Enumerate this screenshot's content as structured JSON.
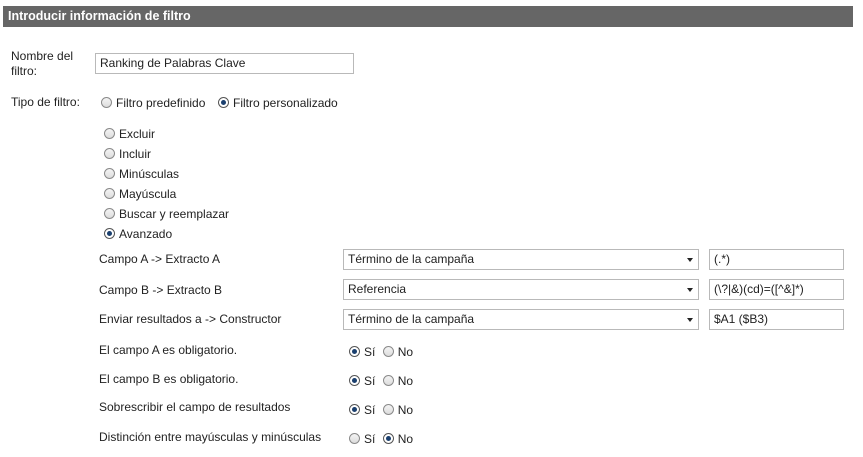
{
  "header": {
    "title": "Introducir información de filtro"
  },
  "name_field": {
    "label_line1": "Nombre del",
    "label_line2": "filtro:",
    "value": "Ranking de Palabras Clave"
  },
  "filter_type": {
    "label": "Tipo de filtro:",
    "options": [
      {
        "label": "Filtro predefinido",
        "selected": false
      },
      {
        "label": "Filtro personalizado",
        "selected": true
      }
    ]
  },
  "custom_options": [
    {
      "label": "Excluir",
      "selected": false
    },
    {
      "label": "Incluir",
      "selected": false
    },
    {
      "label": "Minúsculas",
      "selected": false
    },
    {
      "label": "Mayúscula",
      "selected": false
    },
    {
      "label": "Buscar y reemplazar",
      "selected": false
    },
    {
      "label": "Avanzado",
      "selected": true
    }
  ],
  "advanced": {
    "rows": [
      {
        "label": "Campo A -> Extracto A",
        "select": "Término de la campaña",
        "value": "(.*)"
      },
      {
        "label": "Campo B -> Extracto B",
        "select": "Referencia",
        "value": "(\\?|&)(cd)=([^&]*)"
      },
      {
        "label": "Enviar resultados a -> Constructor",
        "select": "Término de la campaña",
        "value": "$A1 ($B3)"
      }
    ],
    "yes_label": "Sí",
    "no_label": "No",
    "toggles": [
      {
        "label": "El campo A es obligatorio.",
        "value": "Sí"
      },
      {
        "label": "El campo B es obligatorio.",
        "value": "Sí"
      },
      {
        "label": "Sobrescribir el campo de resultados",
        "value": "Sí"
      },
      {
        "label": "Distinción entre mayúsculas y minúsculas",
        "value": "No"
      }
    ]
  }
}
